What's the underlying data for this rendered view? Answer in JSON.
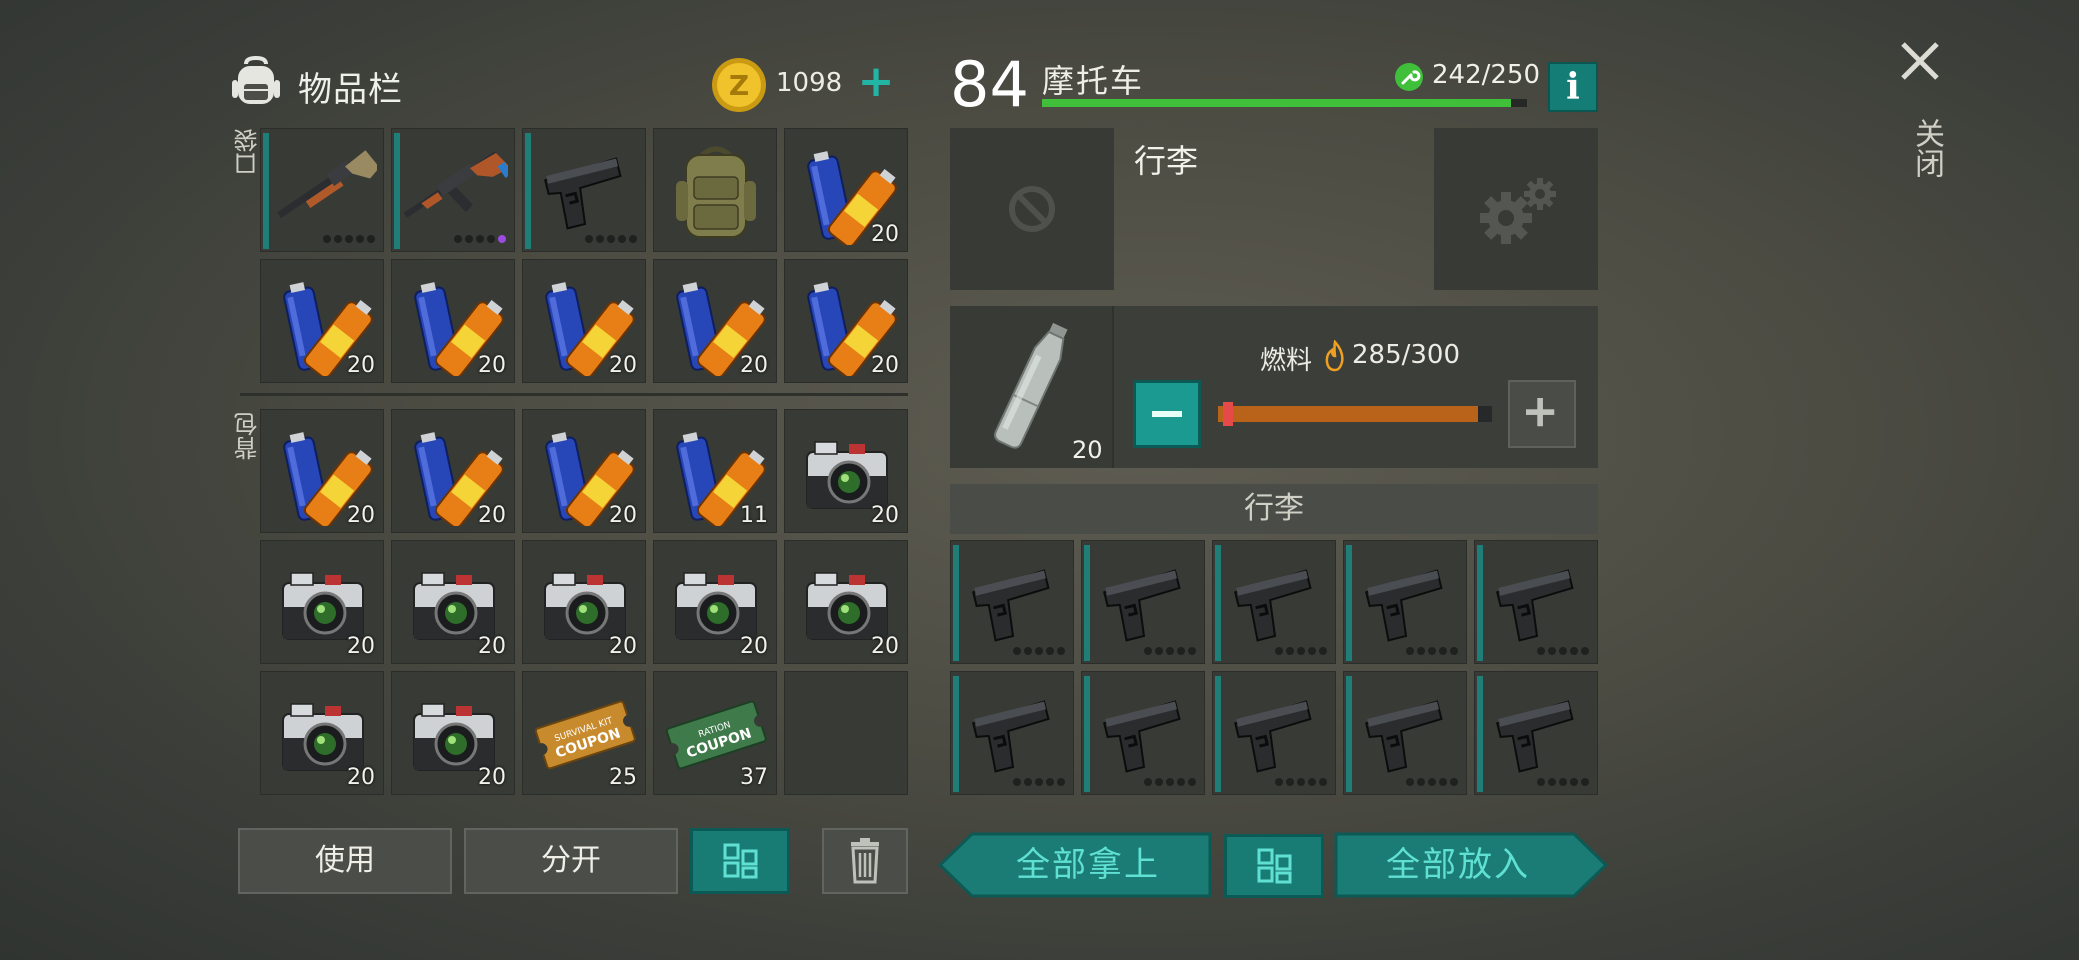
{
  "inventory": {
    "title": "物品栏",
    "coins": "1098",
    "coin_plus": "+",
    "pocket_label": "口袋",
    "backpack_label": "背包",
    "pocket_slots": [
      {
        "item": "shotgun",
        "count": "",
        "weapon": true,
        "special": false
      },
      {
        "item": "ak47",
        "count": "",
        "weapon": true,
        "special": true
      },
      {
        "item": "pistol",
        "count": "",
        "weapon": true,
        "special": false
      },
      {
        "item": "backpack",
        "count": "",
        "weapon": false,
        "special": false
      },
      {
        "item": "battery",
        "count": "20"
      },
      {
        "item": "battery",
        "count": "20"
      },
      {
        "item": "battery",
        "count": "20"
      },
      {
        "item": "battery",
        "count": "20"
      },
      {
        "item": "battery",
        "count": "20"
      },
      {
        "item": "battery",
        "count": "20"
      }
    ],
    "backpack_slots": [
      {
        "item": "battery",
        "count": "20"
      },
      {
        "item": "battery",
        "count": "20"
      },
      {
        "item": "battery",
        "count": "20"
      },
      {
        "item": "battery",
        "count": "11"
      },
      {
        "item": "camera",
        "count": "20"
      },
      {
        "item": "camera",
        "count": "20"
      },
      {
        "item": "camera",
        "count": "20"
      },
      {
        "item": "camera",
        "count": "20"
      },
      {
        "item": "camera",
        "count": "20"
      },
      {
        "item": "camera",
        "count": "20"
      },
      {
        "item": "camera",
        "count": "20"
      },
      {
        "item": "camera",
        "count": "20"
      },
      {
        "item": "survival-kit-coupon",
        "count": "25",
        "text": [
          "SURVIVAL KIT",
          "COUPON"
        ]
      },
      {
        "item": "ration-coupon",
        "count": "37",
        "text": [
          "RATION",
          "COUPON"
        ]
      },
      {
        "item": "empty",
        "count": ""
      }
    ]
  },
  "vehicle": {
    "level": "84",
    "name": "摩托车",
    "durability_text": "242/250",
    "durability_fraction": 0.968,
    "info_label": "i",
    "equipment_title": "行李",
    "fuel_label": "燃料",
    "fuel_value": "285/300",
    "fuel_item_count": "20",
    "fuel_slider_fraction": 0.02,
    "fuel_fill_fraction": 0.95,
    "trunk_label": "行李",
    "trunk_slots": [
      {
        "item": "pistol"
      },
      {
        "item": "pistol"
      },
      {
        "item": "pistol"
      },
      {
        "item": "pistol"
      },
      {
        "item": "pistol"
      },
      {
        "item": "pistol"
      },
      {
        "item": "pistol"
      },
      {
        "item": "pistol"
      },
      {
        "item": "pistol"
      },
      {
        "item": "pistol"
      }
    ]
  },
  "close": {
    "label": "关闭"
  },
  "buttons": {
    "use": "使用",
    "split": "分开",
    "take_all": "全部拿上",
    "store_all": "全部放入"
  },
  "colors": {
    "teal": "#187c75",
    "green_bar": "#3fbf3a",
    "fuel_bar": "#b8621a",
    "rare_dot": "#9b4ce0"
  }
}
